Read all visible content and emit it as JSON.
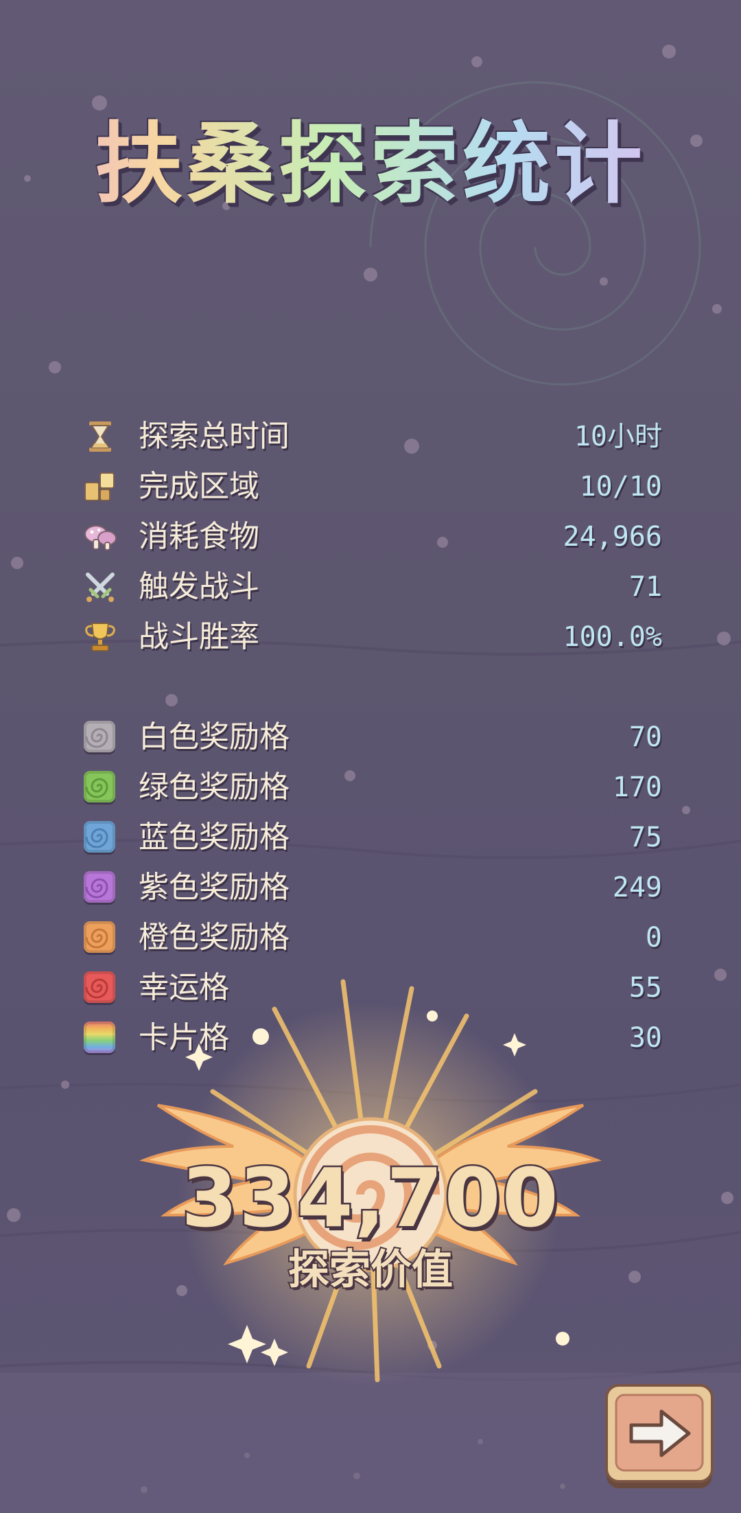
{
  "title": "扶桑探索统计",
  "colors": {
    "background": "#5e5770",
    "label_text": "#f6ecd9",
    "value_text": "#bfe6f2",
    "accent_gold": "#f3c26a"
  },
  "stats": [
    {
      "icon": "hourglass-icon",
      "label": "探索总时间",
      "value": "10小时"
    },
    {
      "icon": "map-tiles-icon",
      "label": "完成区域",
      "value": "10/10"
    },
    {
      "icon": "mushroom-food-icon",
      "label": "消耗食物",
      "value": "24,966"
    },
    {
      "icon": "crossed-swords-icon",
      "label": "触发战斗",
      "value": "71"
    },
    {
      "icon": "trophy-icon",
      "label": "战斗胜率",
      "value": "100.0%"
    }
  ],
  "reward_tiles": [
    {
      "icon": "white-reward-tile-icon",
      "color": "#b4aeb5",
      "label": "白色奖励格",
      "value": "70"
    },
    {
      "icon": "green-reward-tile-icon",
      "color": "#86c55a",
      "label": "绿色奖励格",
      "value": "170"
    },
    {
      "icon": "blue-reward-tile-icon",
      "color": "#6fa5d8",
      "label": "蓝色奖励格",
      "value": "75"
    },
    {
      "icon": "purple-reward-tile-icon",
      "color": "#b877d8",
      "label": "紫色奖励格",
      "value": "249"
    },
    {
      "icon": "orange-reward-tile-icon",
      "color": "#eda05c",
      "label": "橙色奖励格",
      "value": "0"
    },
    {
      "icon": "lucky-tile-icon",
      "color": "#e85a5a",
      "label": "幸运格",
      "value": "55"
    },
    {
      "icon": "card-tile-icon",
      "color": "rainbow",
      "label": "卡片格",
      "value": "30"
    }
  ],
  "total": {
    "value": "334,700",
    "label": "探索价值"
  },
  "next_button": {
    "icon": "right-arrow-icon"
  }
}
